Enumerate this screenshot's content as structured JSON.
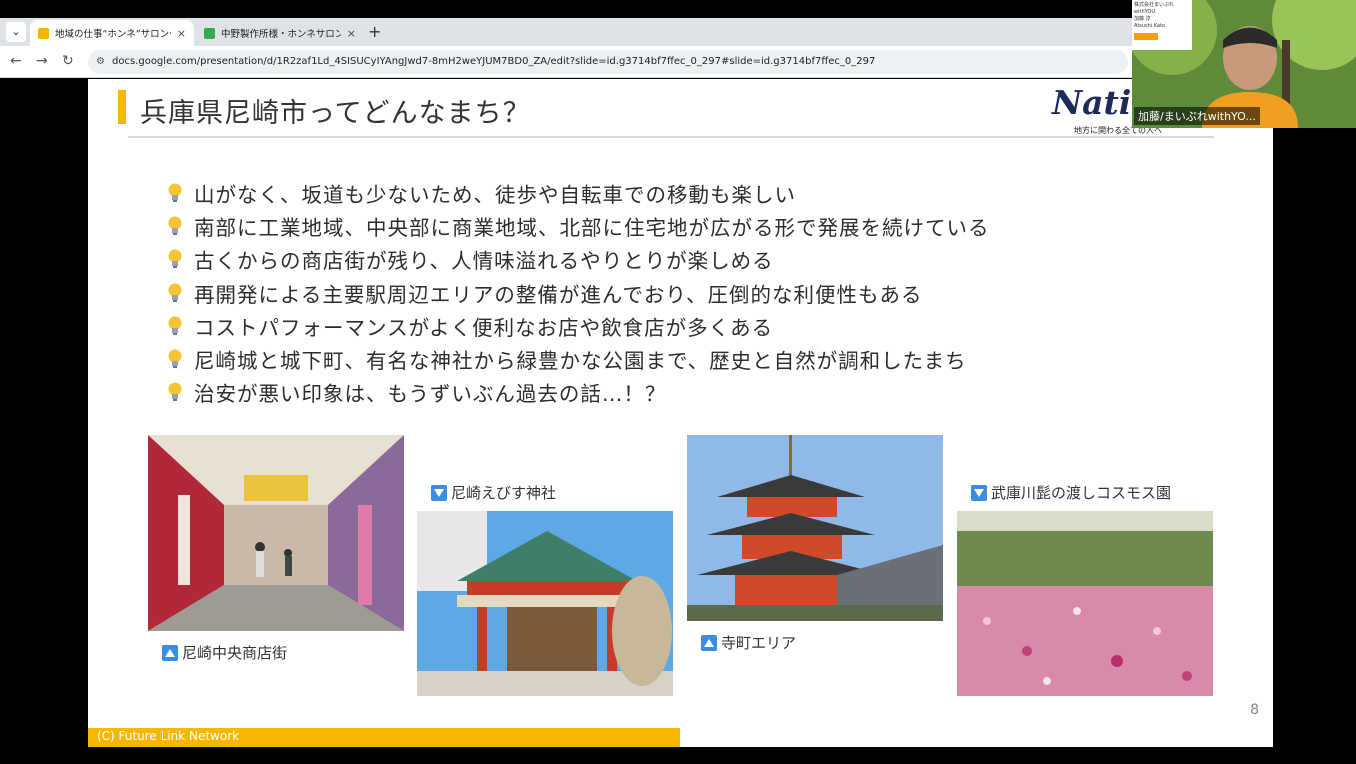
{
  "browser": {
    "tabs": [
      {
        "title": "地域の仕事“ホンネ”サロン〜尼崎",
        "active": true,
        "favicon_color": "#f4b400"
      },
      {
        "title": "中野製作所様・ホンネサロン尼崎",
        "active": false,
        "favicon_color": "#34a853"
      }
    ],
    "tab_close": "×",
    "new_tab": "+",
    "tab_menu": "⌄",
    "nav": {
      "back": "←",
      "forward": "→",
      "reload": "↻"
    },
    "url": "docs.google.com/presentation/d/1R2zaf1Ld_4SISUCyIYAngJwd7-8mH2weYJUM7BD0_ZA/edit?slide=id.g3714bf7ffec_0_297#slide=id.g3714bf7ffec_0_297"
  },
  "slide": {
    "title": "兵庫県尼崎市ってどんなまち？",
    "logo": {
      "word": "Nativ",
      "tagline": "地方に関わる全ての人へ"
    },
    "bullets": [
      "山がなく、坂道も少ないため、徒歩や自転車での移動も楽しい",
      "南部に工業地域、中央部に商業地域、北部に住宅地が広がる形で発展を続けている",
      "古くからの商店街が残り、人情味溢れるやりとりが楽しめる",
      "再開発による主要駅周辺エリアの整備が進んでおり、圧倒的な利便性もある",
      "コストパフォーマンスがよく便利なお店や飲食店が多くある",
      "尼崎城と城下町、有名な神社から緑豊かな公園まで、歴史と自然が調和したまち",
      "治安が悪い印象は、もうずいぶん過去の話…！？"
    ],
    "captions": {
      "shopping_street": "尼崎中央商店街",
      "shrine": "尼崎えびす神社",
      "temple": "寺町エリア",
      "cosmos": "武庫川髭の渡しコスモス園"
    },
    "page_number": "8",
    "footer": "(C) Future Link Network",
    "colors": {
      "accent": "#f5b700",
      "caption_icon": "#3a8de0",
      "text": "#2d2d2d"
    }
  },
  "video": {
    "participant_name": "加藤/まいぷれwithYO...",
    "nameplate_lines": [
      "株式会社まいぷれwithYOU",
      "加藤 淳",
      "Atsushi Kato"
    ]
  }
}
